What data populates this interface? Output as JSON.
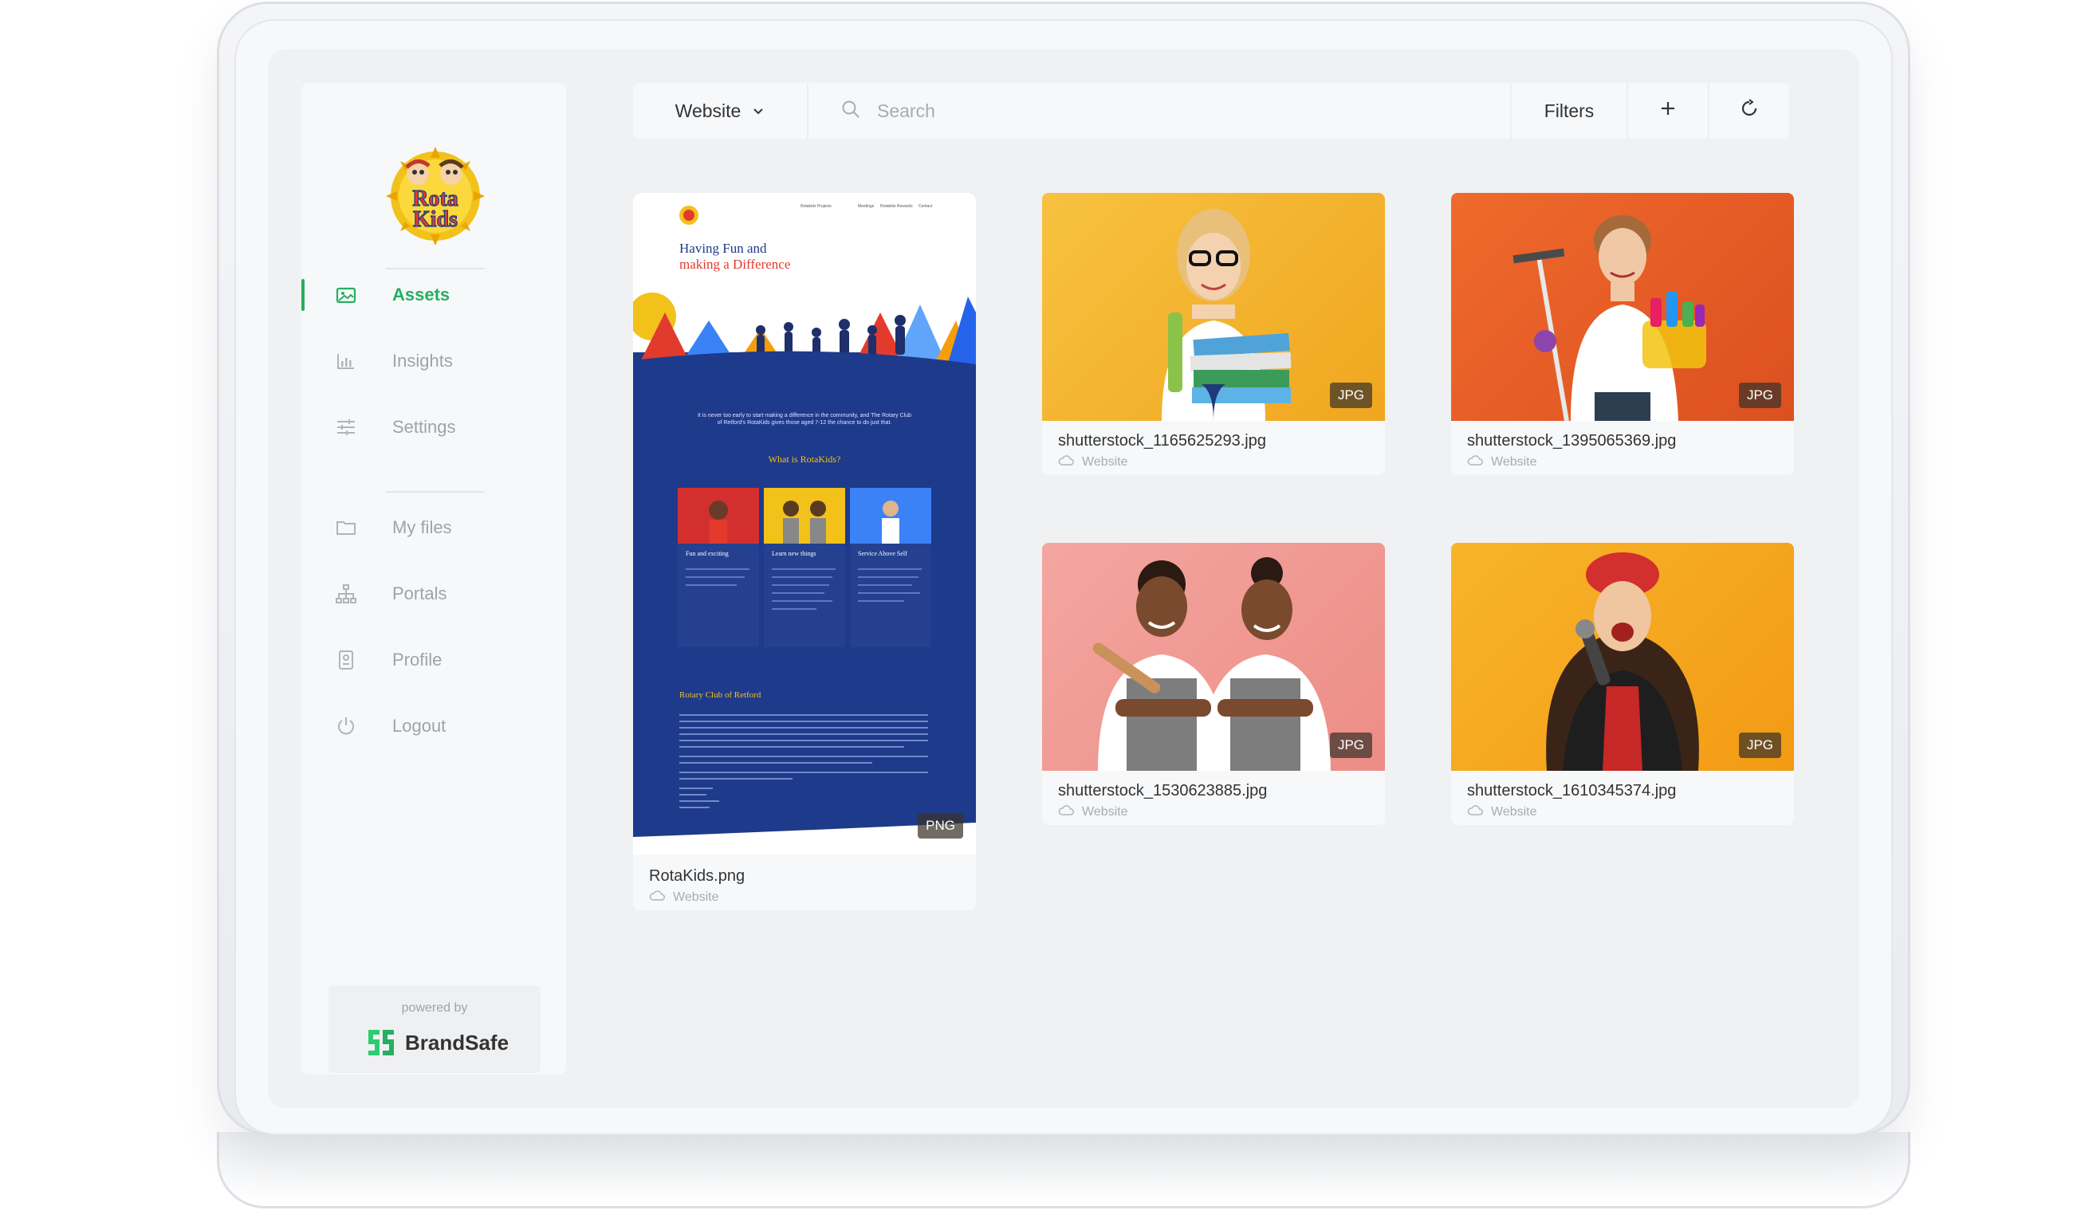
{
  "brand": {
    "client_logo_text": [
      "Rota",
      "Kids"
    ],
    "accent": "#27ae60"
  },
  "sidebar": {
    "items": [
      {
        "label": "Assets",
        "icon": "image-icon",
        "active": true
      },
      {
        "label": "Insights",
        "icon": "bar-chart-icon",
        "active": false
      },
      {
        "label": "Settings",
        "icon": "sliders-icon",
        "active": false
      },
      {
        "label": "My files",
        "icon": "folder-icon",
        "active": false
      },
      {
        "label": "Portals",
        "icon": "sitemap-icon",
        "active": false
      },
      {
        "label": "Profile",
        "icon": "id-badge-icon",
        "active": false
      },
      {
        "label": "Logout",
        "icon": "power-icon",
        "active": false
      }
    ],
    "powered_by": "powered by",
    "powered_brand": "BrandSafe"
  },
  "toolbar": {
    "collection": "Website",
    "search_placeholder": "Search",
    "filters_label": "Filters",
    "add_label": "+",
    "refresh_icon": "refresh-icon"
  },
  "assets": [
    {
      "name": "RotaKids.png",
      "type": "PNG",
      "location": "Website",
      "preview": {
        "nav": [
          "Rotakids Projects",
          "Meetings",
          "Rotakids Rewards",
          "Contact"
        ],
        "hero_line1": "Having Fun and",
        "hero_line2": "making a Difference",
        "intro": "It is never too early to start making a difference in the community, and The Rotary Club of Retford's RotaKids gives those aged 7-12 the chance to do just that.",
        "section_title": "What is RotaKids?",
        "features": [
          "Fun and exciting",
          "Learn new things",
          "Service Above Self"
        ],
        "club_title": "Rotary Club of Retford"
      }
    },
    {
      "name": "shutterstock_1165625293.jpg",
      "type": "JPG",
      "location": "Website",
      "bg": "#f4b431"
    },
    {
      "name": "shutterstock_1395065369.jpg",
      "type": "JPG",
      "location": "Website",
      "bg": "#e8602a"
    },
    {
      "name": "shutterstock_1530623885.jpg",
      "type": "JPG",
      "location": "Website",
      "bg": "#f19d96"
    },
    {
      "name": "shutterstock_1610345374.jpg",
      "type": "JPG",
      "location": "Website",
      "bg": "#f4a820"
    }
  ]
}
